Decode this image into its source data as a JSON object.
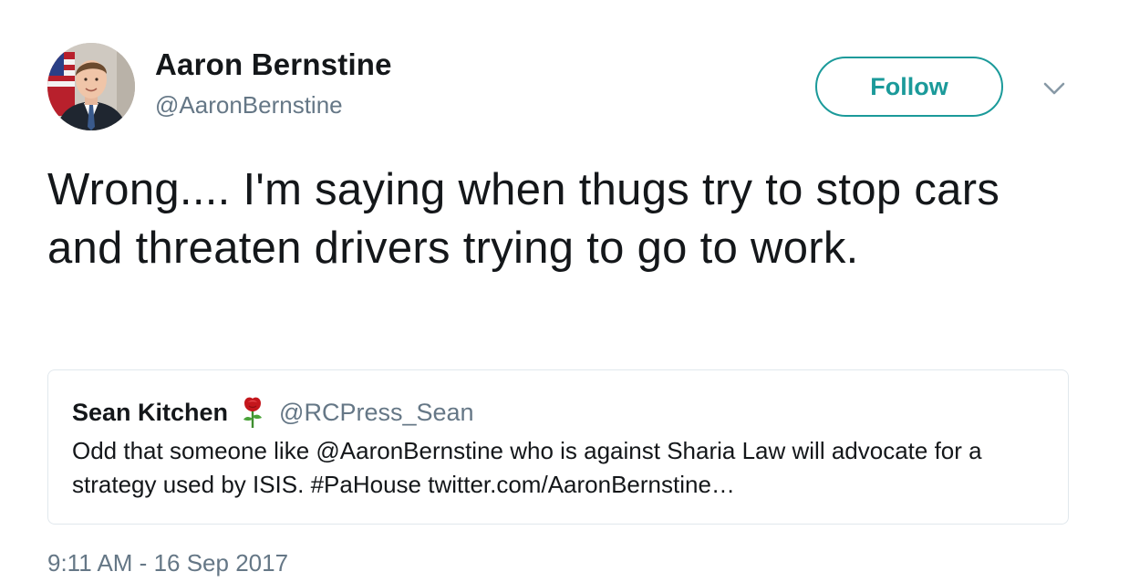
{
  "user": {
    "name": "Aaron Bernstine",
    "handle": "@AaronBernstine"
  },
  "actions": {
    "follow_label": "Follow",
    "more_icon": "chevron-down-icon"
  },
  "tweet": {
    "text": "Wrong.... I'm saying when thugs try to stop cars and threaten drivers trying to go to work.",
    "timestamp": "9:11 AM - 16 Sep 2017"
  },
  "quoted_tweet": {
    "name": "Sean Kitchen",
    "name_emoji_icon": "rose-icon",
    "handle": "@RCPress_Sean",
    "text": "Odd that someone like @AaronBernstine who is against Sharia Law will advocate for a strategy used by ISIS.  #PaHouse twitter.com/AaronBernstine…"
  },
  "colors": {
    "accent": "#1b9a9a",
    "name": "#14171a",
    "secondary": "#657786",
    "card_border": "#e1e8ed"
  }
}
